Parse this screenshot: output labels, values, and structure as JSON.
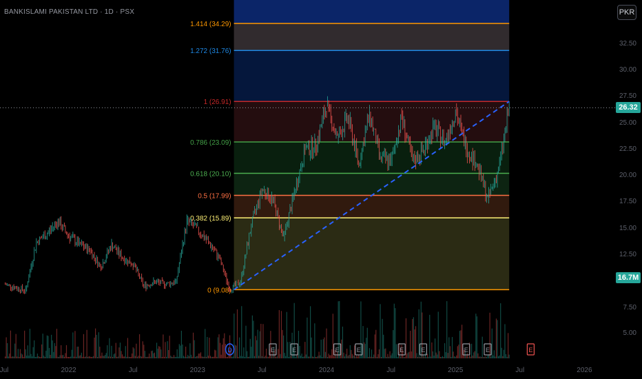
{
  "header": {
    "title": "BANKISLAMI PAKISTAN LTD · 1D · PSX",
    "currency_button": "PKR"
  },
  "badges": {
    "last_price": "26.32",
    "last_price_color": "#26a69a",
    "volume": "16.7M",
    "volume_color": "#26a69a"
  },
  "chart_data": {
    "type": "line",
    "title": "BANKISLAMI PAKISTAN LTD · 1D · PSX",
    "yaxis": {
      "range": [
        5,
        37
      ],
      "ticks": [
        5.0,
        7.5,
        10.0,
        12.5,
        15.0,
        17.5,
        20.0,
        22.5,
        25.0,
        27.5,
        30.0,
        32.5
      ]
    },
    "xaxis": {
      "ticks": [
        "Jul",
        "2022",
        "Jul",
        "2023",
        "Jul",
        "2024",
        "Jul",
        "2025",
        "Jul",
        "2026"
      ]
    },
    "price_series": {
      "name": "Close",
      "points": [
        [
          "Jul 2021",
          9.6
        ],
        [
          "Sep 2021",
          9.0
        ],
        [
          "Oct 2021",
          13.6
        ],
        [
          "Nov 2021",
          14.4
        ],
        [
          "Dec 2021",
          15.6
        ],
        [
          "Jan 2022",
          14.2
        ],
        [
          "Feb 2022",
          13.4
        ],
        [
          "Mar 2022",
          12.8
        ],
        [
          "Apr 2022",
          11.2
        ],
        [
          "May 2022",
          13.4
        ],
        [
          "Jun 2022",
          12.1
        ],
        [
          "Jul 2022",
          11.5
        ],
        [
          "Aug 2022",
          9.4
        ],
        [
          "Sep 2022",
          9.8
        ],
        [
          "Oct 2022",
          9.6
        ],
        [
          "Nov 2022",
          9.8
        ],
        [
          "Dec 2022",
          15.6
        ],
        [
          "Jan 2023",
          14.8
        ],
        [
          "Feb 2023",
          13.6
        ],
        [
          "Mar 2023",
          12.1
        ],
        [
          "Apr 2023",
          9.1
        ],
        [
          "May 2023",
          9.8
        ],
        [
          "Jun 2023",
          15.2
        ],
        [
          "Jul 2023",
          18.6
        ],
        [
          "Aug 2023",
          17.6
        ],
        [
          "Sep 2023",
          14.0
        ],
        [
          "Oct 2023",
          18.2
        ],
        [
          "Nov 2023",
          22.4
        ],
        [
          "Dec 2023",
          22.7
        ],
        [
          "Jan 2024",
          26.5
        ],
        [
          "Feb 2024",
          23.5
        ],
        [
          "Mar 2024",
          25.4
        ],
        [
          "Apr 2024",
          21.0
        ],
        [
          "May 2024",
          25.8
        ],
        [
          "Jun 2024",
          21.6
        ],
        [
          "Jul 2024",
          21.2
        ],
        [
          "Aug 2024",
          25.5
        ],
        [
          "Sep 2024",
          21.2
        ],
        [
          "Oct 2024",
          22.3
        ],
        [
          "Nov 2024",
          24.5
        ],
        [
          "Dec 2024",
          23.1
        ],
        [
          "Jan 2025",
          26.0
        ],
        [
          "Feb 2025",
          22.5
        ],
        [
          "Mar 2025",
          21.0
        ],
        [
          "Apr 2025",
          17.6
        ],
        [
          "May 2025",
          20.4
        ],
        [
          "Jun 2025",
          26.32
        ]
      ]
    },
    "volume_series": {
      "name": "Volume",
      "last_value": "16.7M"
    },
    "fibonacci": {
      "levels": [
        {
          "label": "0 (9.08)",
          "ratio": 0,
          "price": 9.08,
          "color": "#ff9800"
        },
        {
          "label": "0.382 (15.89)",
          "ratio": 0.382,
          "price": 15.89,
          "color": "#fff176"
        },
        {
          "label": "0.5 (17.99)",
          "ratio": 0.5,
          "price": 17.99,
          "color": "#ff7043"
        },
        {
          "label": "0.618 (20.10)",
          "ratio": 0.618,
          "price": 20.1,
          "color": "#4caf50"
        },
        {
          "label": "0.786 (23.09)",
          "ratio": 0.786,
          "price": 23.09,
          "color": "#43a047"
        },
        {
          "label": "1 (26.91)",
          "ratio": 1,
          "price": 26.91,
          "color": "#c62828"
        },
        {
          "label": "1.272 (31.76)",
          "ratio": 1.272,
          "price": 31.76,
          "color": "#1e88e5"
        },
        {
          "label": "1.414 (34.29)",
          "ratio": 1.414,
          "price": 34.29,
          "color": "#ff9800"
        }
      ],
      "zone_colors": [
        "#333318",
        "#3a1f10",
        "#0f2a15",
        "#0b2410",
        "#2a0f12",
        "#061b46",
        "#3a3236",
        "#0d2c7a"
      ],
      "start_date": "Apr 2023",
      "end_date": "Jun 2025"
    },
    "trendline": {
      "from": [
        "Apr 2023",
        9.08
      ],
      "to": [
        "Jun 2025",
        26.91
      ],
      "color": "#2962ff",
      "style": "dashed"
    },
    "event_markers": [
      {
        "label": "D",
        "kind": "dividend",
        "date": "Apr 2023"
      },
      {
        "label": "E",
        "kind": "earnings",
        "date": "Aug 2023"
      },
      {
        "label": "E",
        "kind": "earnings",
        "date": "Oct 2023"
      },
      {
        "label": "E",
        "kind": "earnings",
        "date": "Feb 2024"
      },
      {
        "label": "E",
        "kind": "earnings",
        "date": "Apr 2024"
      },
      {
        "label": "E",
        "kind": "earnings",
        "date": "Aug 2024"
      },
      {
        "label": "E",
        "kind": "earnings",
        "date": "Oct 2024"
      },
      {
        "label": "E",
        "kind": "earnings",
        "date": "Feb 2025"
      },
      {
        "label": "E",
        "kind": "earnings",
        "date": "Apr 2025"
      },
      {
        "label": "E",
        "kind": "earnings_upcoming",
        "date": "Aug 2025"
      }
    ],
    "grid": false,
    "colors": {
      "up": "#26a69a",
      "down": "#ef5350"
    }
  }
}
